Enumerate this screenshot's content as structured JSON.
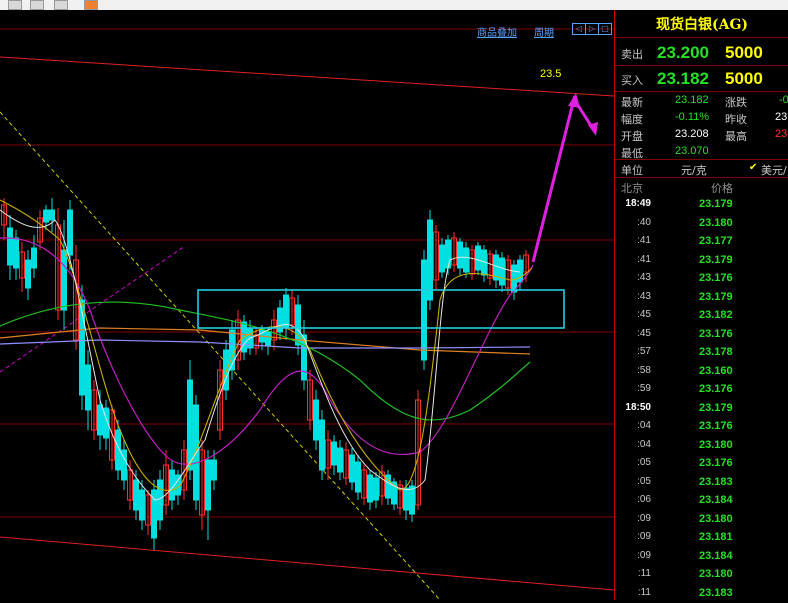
{
  "chart_header": {
    "add_product_link": "商品叠加",
    "period_link": "周期",
    "nav_buttons": [
      "◁",
      "▷",
      "□"
    ]
  },
  "annotation": {
    "target_price": "23.5"
  },
  "chart_data": {
    "type": "candlestick",
    "title": "",
    "annotations": [
      "23.5"
    ]
  },
  "quote": {
    "title": "现货白银(AG)",
    "sell_label": "卖出",
    "sell_price": "23.200",
    "sell_qty": "5000",
    "buy_label": "买入",
    "buy_price": "23.182",
    "buy_qty": "5000",
    "latest_label": "最新",
    "latest_value": "23.182",
    "change_label": "涨跌",
    "change_value": "-0",
    "amplitude_label": "幅度",
    "amplitude_value": "-0.11%",
    "prev_close_label": "昨收",
    "prev_close_value": "23",
    "open_label": "开盘",
    "open_value": "23.208",
    "high_label": "最高",
    "high_value": "23",
    "low_label": "最低",
    "low_value": "23.070",
    "unit_label": "单位",
    "unit_value": "元/克",
    "currency_option": "美元/",
    "city_label": "北京",
    "price_col_label": "价格"
  },
  "ticks": [
    {
      "time": "18:49",
      "price": "23.179"
    },
    {
      "time": ":40",
      "price": "23.180"
    },
    {
      "time": ":41",
      "price": "23.177"
    },
    {
      "time": ":41",
      "price": "23.179"
    },
    {
      "time": ":43",
      "price": "23.176"
    },
    {
      "time": ":43",
      "price": "23.179"
    },
    {
      "time": ":45",
      "price": "23.182"
    },
    {
      "time": ":45",
      "price": "23.176"
    },
    {
      "time": ":57",
      "price": "23.178"
    },
    {
      "time": ":58",
      "price": "23.160"
    },
    {
      "time": ":59",
      "price": "23.176"
    },
    {
      "time": "18:50",
      "price": "23.179"
    },
    {
      "time": ":04",
      "price": "23.176"
    },
    {
      "time": ":04",
      "price": "23.180"
    },
    {
      "time": ":05",
      "price": "23.176"
    },
    {
      "time": ":05",
      "price": "23.183"
    },
    {
      "time": ":06",
      "price": "23.184"
    },
    {
      "time": ":09",
      "price": "23.180"
    },
    {
      "time": ":09",
      "price": "23.181"
    },
    {
      "time": ":09",
      "price": "23.184"
    },
    {
      "time": ":11",
      "price": "23.180"
    },
    {
      "time": ":11",
      "price": "23.183"
    }
  ],
  "colors": {
    "up": "#ff3030",
    "down": "#00e0e0",
    "price_green": "#26e026",
    "title_yellow": "#ffff00",
    "grid_red": "#800000"
  }
}
